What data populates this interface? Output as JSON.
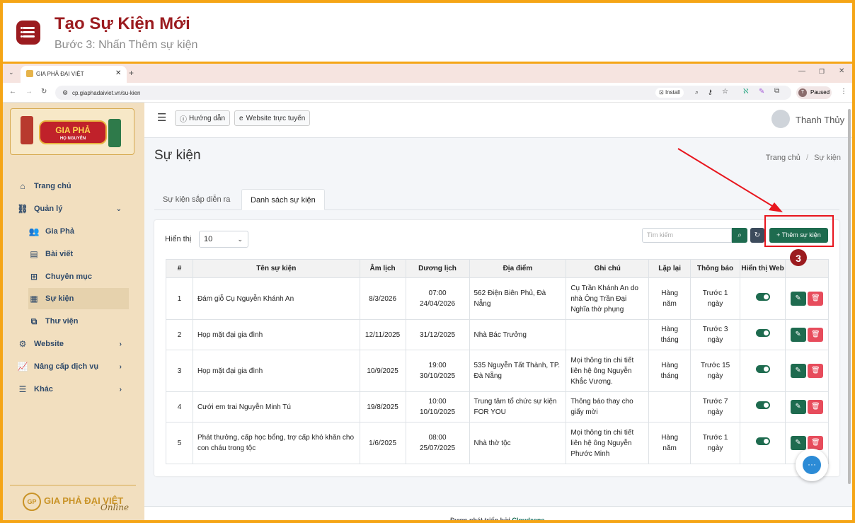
{
  "tutorial": {
    "title": "Tạo Sự Kiện Mới",
    "subtitle": "Bước 3: Nhấn Thêm sự kiện",
    "step_badge": "3"
  },
  "browser": {
    "tab_title": "GIA PHẢ ĐẠI VIỆT",
    "url": "cp.giaphadaiviet.vn/su-kien",
    "install_label": "Install",
    "profile_initial": "T",
    "profile_status": "Paused"
  },
  "sidebar": {
    "logo_text": "GIA PHẢ",
    "logo_sub": "HỌ NGUYỄN",
    "footer_brand": "GIA PHẢ ĐẠI VIỆT",
    "footer_script": "Online",
    "items": [
      {
        "label": "Trang chủ",
        "icon": "home-icon"
      },
      {
        "label": "Quản lý",
        "icon": "sitemap-icon"
      },
      {
        "label": "Gia Phả",
        "icon": "users-icon"
      },
      {
        "label": "Bài viết",
        "icon": "newspaper-icon"
      },
      {
        "label": "Chuyên mục",
        "icon": "grid-icon"
      },
      {
        "label": "Sự kiện",
        "icon": "calendar-icon"
      },
      {
        "label": "Thư viện",
        "icon": "images-icon"
      },
      {
        "label": "Website",
        "icon": "gear-icon"
      },
      {
        "label": "Nâng cấp dịch vụ",
        "icon": "chart-icon"
      },
      {
        "label": "Khác",
        "icon": "bars-icon"
      }
    ]
  },
  "topbar": {
    "guide_label": "Hướng dẫn",
    "website_label": "Website trực tuyến",
    "user_name": "Thanh Thủy"
  },
  "page": {
    "title": "Sự kiện",
    "breadcrumb_home": "Trang chủ",
    "breadcrumb_sep": "/",
    "breadcrumb_current": "Sự kiện",
    "tabs": [
      "Sự kiện sắp diễn ra",
      "Danh sách sự kiện"
    ]
  },
  "list": {
    "show_label": "Hiển thị",
    "page_size": "10",
    "search_placeholder": "Tìm kiếm",
    "add_button": "Thêm sự kiện",
    "columns": [
      "#",
      "Tên sự kiện",
      "Âm lịch",
      "Dương lịch",
      "Địa điểm",
      "Ghi chú",
      "Lặp lại",
      "Thông báo",
      "Hiển thị Web"
    ],
    "rows": [
      {
        "num": "1",
        "name": "Đám giỗ Cụ Nguyễn Khánh An",
        "lunar": "8/3/2026",
        "solar_time": "07:00",
        "solar_date": "24/04/2026",
        "place": "562 Điện Biên Phủ, Đà Nẵng",
        "note": "Cụ Trần Khánh An do nhà Ông Trần Đại Nghĩa thờ phụng",
        "repeat": "Hàng năm",
        "notify": "Trước 1 ngày"
      },
      {
        "num": "2",
        "name": "Họp mặt đại gia đình",
        "lunar": "12/11/2025",
        "solar_time": "",
        "solar_date": "31/12/2025",
        "place": "Nhà Bác Trưởng",
        "note": "",
        "repeat": "Hàng tháng",
        "notify": "Trước 3 ngày"
      },
      {
        "num": "3",
        "name": "Họp mặt đại gia đình",
        "lunar": "10/9/2025",
        "solar_time": "19:00",
        "solar_date": "30/10/2025",
        "place": "535 Nguyễn Tất Thành, TP. Đà Nẵng",
        "note": "Mọi thông tin chi tiết liên hệ ông Nguyễn Khắc Vương.",
        "repeat": "Hàng tháng",
        "notify": "Trước 15 ngày"
      },
      {
        "num": "4",
        "name": "Cưới em trai Nguyễn Minh Tú",
        "lunar": "19/8/2025",
        "solar_time": "10:00",
        "solar_date": "10/10/2025",
        "place": "Trung tâm tổ chức sự kiện FOR YOU",
        "note": "Thông báo thay cho giấy mời",
        "repeat": "",
        "notify": "Trước 7 ngày"
      },
      {
        "num": "5",
        "name": "Phát thưởng, cấp học bổng, trợ cấp khó khăn cho con cháu trong tộc",
        "lunar": "1/6/2025",
        "solar_time": "08:00",
        "solar_date": "25/07/2025",
        "place": "Nhà thờ tộc",
        "note": "Mọi thông tin chi tiết liên hệ ông Nguyễn Phước Minh",
        "repeat": "Hàng năm",
        "notify": "Trước 1 ngày"
      }
    ]
  },
  "footer": {
    "prefix": "Được phát triển bởi ",
    "brand": "Cloudzone",
    "suffix": "."
  },
  "colors": {
    "accent_red": "#9b1b1f",
    "frame_orange": "#f5a516",
    "success_green": "#1e6b4f",
    "danger": "#e74c5c",
    "annotation_red": "#e8161e"
  }
}
